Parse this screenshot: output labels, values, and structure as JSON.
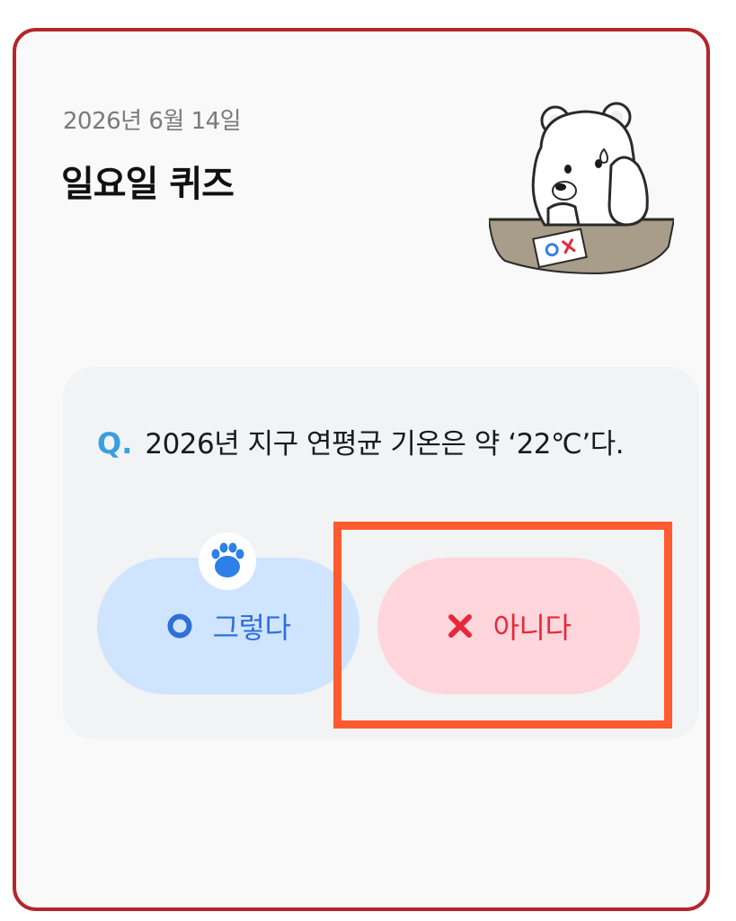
{
  "header": {
    "date": "2026년 6월 14일",
    "title": "일요일 퀴즈"
  },
  "quiz": {
    "question_marker": "Q.",
    "question_text": "2026년 지구 연평균 기온은 약 ‘22℃’다.",
    "answers": [
      {
        "label": "그렇다",
        "icon": "circle-o-icon",
        "color": "#2f6fd8"
      },
      {
        "label": "아니다",
        "icon": "x-mark-icon",
        "color": "#e8283a"
      }
    ]
  },
  "colors": {
    "frame_border": "#b3262b",
    "accent_blue": "#3a9fe0",
    "highlight": "#ff5a30"
  }
}
